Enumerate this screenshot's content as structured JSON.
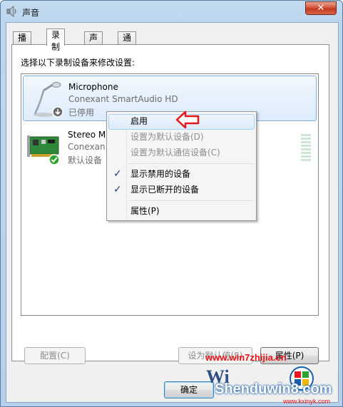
{
  "window": {
    "title": "声音",
    "close_label": "✕"
  },
  "tabs": [
    {
      "label": "播放",
      "active": false
    },
    {
      "label": "录制",
      "active": true
    },
    {
      "label": "声音",
      "active": false
    },
    {
      "label": "通信",
      "active": false
    }
  ],
  "panel": {
    "instruction": "选择以下录制设备来修改设置:"
  },
  "devices": [
    {
      "name": "Microphone",
      "driver": "Conexant SmartAudio HD",
      "status": "已停用",
      "icon": "microphone-icon",
      "badge": "disabled-arrow-badge",
      "selected": true
    },
    {
      "name": "Stereo M",
      "driver": "Conexan",
      "status": "默认设备",
      "icon": "sound-card-icon",
      "badge": "green-check-badge",
      "selected": false
    }
  ],
  "context_menu": {
    "items": [
      {
        "label": "启用",
        "enabled": true,
        "checked": false,
        "hover": true
      },
      {
        "label": "设置为默认设备(D)",
        "enabled": false,
        "checked": false
      },
      {
        "label": "设置为默认通信设备(C)",
        "enabled": false,
        "checked": false
      },
      {
        "label": "显示禁用的设备",
        "enabled": true,
        "checked": true
      },
      {
        "label": "显示已断开的设备",
        "enabled": true,
        "checked": true
      },
      {
        "label": "属性(P)",
        "enabled": true,
        "checked": false
      }
    ],
    "check_glyph": "✓"
  },
  "buttons": {
    "configure": "配置(C)",
    "set_default": "设为默认值(S)",
    "properties": "属性(P)",
    "ok": "确定"
  },
  "watermark": {
    "url": "www.win7zhijia.cn",
    "brand": "Shenduwin8.com",
    "site": "www.kxinyk.com"
  },
  "colors": {
    "selection_border": "#84acdd",
    "annotation_red": "#e8151b",
    "check_green": "#2ca42c"
  }
}
